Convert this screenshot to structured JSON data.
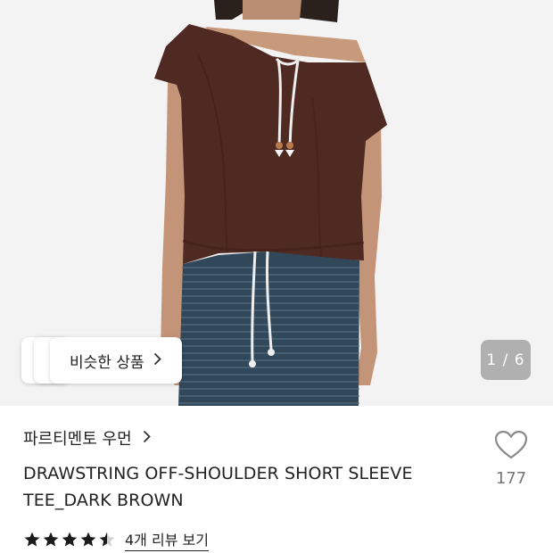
{
  "product": {
    "image_alt": "model wearing dark brown off-shoulder drawstring tee",
    "counter": "1 / 6",
    "similar_label": "비슷한 상품",
    "brand_label": "파르티멘토 우먼",
    "title": "DRAWSTRING OFF-SHOULDER SHORT SLEEVE TEE_DARK BROWN",
    "like_count": "177",
    "rating": 4.5,
    "reviews_label": "4개 리뷰 보기"
  },
  "icons": {
    "similar_chevron": "chevron-right-icon",
    "brand_chevron": "chevron-right-icon",
    "like": "heart-outline-icon",
    "star": "star-icon"
  },
  "colors": {
    "garment": "#4f2a22",
    "skirt": "#31475a",
    "counter_bg": "#8c8c8c"
  }
}
